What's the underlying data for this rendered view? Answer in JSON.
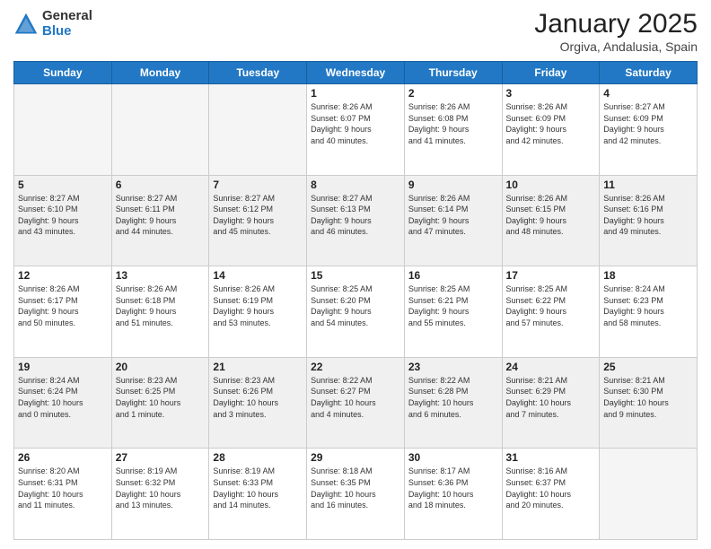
{
  "header": {
    "logo_general": "General",
    "logo_blue": "Blue",
    "title": "January 2025",
    "location": "Orgiva, Andalusia, Spain"
  },
  "days_of_week": [
    "Sunday",
    "Monday",
    "Tuesday",
    "Wednesday",
    "Thursday",
    "Friday",
    "Saturday"
  ],
  "weeks": [
    {
      "stripe": false,
      "days": [
        {
          "num": "",
          "info": ""
        },
        {
          "num": "",
          "info": ""
        },
        {
          "num": "",
          "info": ""
        },
        {
          "num": "1",
          "info": "Sunrise: 8:26 AM\nSunset: 6:07 PM\nDaylight: 9 hours\nand 40 minutes."
        },
        {
          "num": "2",
          "info": "Sunrise: 8:26 AM\nSunset: 6:08 PM\nDaylight: 9 hours\nand 41 minutes."
        },
        {
          "num": "3",
          "info": "Sunrise: 8:26 AM\nSunset: 6:09 PM\nDaylight: 9 hours\nand 42 minutes."
        },
        {
          "num": "4",
          "info": "Sunrise: 8:27 AM\nSunset: 6:09 PM\nDaylight: 9 hours\nand 42 minutes."
        }
      ]
    },
    {
      "stripe": true,
      "days": [
        {
          "num": "5",
          "info": "Sunrise: 8:27 AM\nSunset: 6:10 PM\nDaylight: 9 hours\nand 43 minutes."
        },
        {
          "num": "6",
          "info": "Sunrise: 8:27 AM\nSunset: 6:11 PM\nDaylight: 9 hours\nand 44 minutes."
        },
        {
          "num": "7",
          "info": "Sunrise: 8:27 AM\nSunset: 6:12 PM\nDaylight: 9 hours\nand 45 minutes."
        },
        {
          "num": "8",
          "info": "Sunrise: 8:27 AM\nSunset: 6:13 PM\nDaylight: 9 hours\nand 46 minutes."
        },
        {
          "num": "9",
          "info": "Sunrise: 8:26 AM\nSunset: 6:14 PM\nDaylight: 9 hours\nand 47 minutes."
        },
        {
          "num": "10",
          "info": "Sunrise: 8:26 AM\nSunset: 6:15 PM\nDaylight: 9 hours\nand 48 minutes."
        },
        {
          "num": "11",
          "info": "Sunrise: 8:26 AM\nSunset: 6:16 PM\nDaylight: 9 hours\nand 49 minutes."
        }
      ]
    },
    {
      "stripe": false,
      "days": [
        {
          "num": "12",
          "info": "Sunrise: 8:26 AM\nSunset: 6:17 PM\nDaylight: 9 hours\nand 50 minutes."
        },
        {
          "num": "13",
          "info": "Sunrise: 8:26 AM\nSunset: 6:18 PM\nDaylight: 9 hours\nand 51 minutes."
        },
        {
          "num": "14",
          "info": "Sunrise: 8:26 AM\nSunset: 6:19 PM\nDaylight: 9 hours\nand 53 minutes."
        },
        {
          "num": "15",
          "info": "Sunrise: 8:25 AM\nSunset: 6:20 PM\nDaylight: 9 hours\nand 54 minutes."
        },
        {
          "num": "16",
          "info": "Sunrise: 8:25 AM\nSunset: 6:21 PM\nDaylight: 9 hours\nand 55 minutes."
        },
        {
          "num": "17",
          "info": "Sunrise: 8:25 AM\nSunset: 6:22 PM\nDaylight: 9 hours\nand 57 minutes."
        },
        {
          "num": "18",
          "info": "Sunrise: 8:24 AM\nSunset: 6:23 PM\nDaylight: 9 hours\nand 58 minutes."
        }
      ]
    },
    {
      "stripe": true,
      "days": [
        {
          "num": "19",
          "info": "Sunrise: 8:24 AM\nSunset: 6:24 PM\nDaylight: 10 hours\nand 0 minutes."
        },
        {
          "num": "20",
          "info": "Sunrise: 8:23 AM\nSunset: 6:25 PM\nDaylight: 10 hours\nand 1 minute."
        },
        {
          "num": "21",
          "info": "Sunrise: 8:23 AM\nSunset: 6:26 PM\nDaylight: 10 hours\nand 3 minutes."
        },
        {
          "num": "22",
          "info": "Sunrise: 8:22 AM\nSunset: 6:27 PM\nDaylight: 10 hours\nand 4 minutes."
        },
        {
          "num": "23",
          "info": "Sunrise: 8:22 AM\nSunset: 6:28 PM\nDaylight: 10 hours\nand 6 minutes."
        },
        {
          "num": "24",
          "info": "Sunrise: 8:21 AM\nSunset: 6:29 PM\nDaylight: 10 hours\nand 7 minutes."
        },
        {
          "num": "25",
          "info": "Sunrise: 8:21 AM\nSunset: 6:30 PM\nDaylight: 10 hours\nand 9 minutes."
        }
      ]
    },
    {
      "stripe": false,
      "days": [
        {
          "num": "26",
          "info": "Sunrise: 8:20 AM\nSunset: 6:31 PM\nDaylight: 10 hours\nand 11 minutes."
        },
        {
          "num": "27",
          "info": "Sunrise: 8:19 AM\nSunset: 6:32 PM\nDaylight: 10 hours\nand 13 minutes."
        },
        {
          "num": "28",
          "info": "Sunrise: 8:19 AM\nSunset: 6:33 PM\nDaylight: 10 hours\nand 14 minutes."
        },
        {
          "num": "29",
          "info": "Sunrise: 8:18 AM\nSunset: 6:35 PM\nDaylight: 10 hours\nand 16 minutes."
        },
        {
          "num": "30",
          "info": "Sunrise: 8:17 AM\nSunset: 6:36 PM\nDaylight: 10 hours\nand 18 minutes."
        },
        {
          "num": "31",
          "info": "Sunrise: 8:16 AM\nSunset: 6:37 PM\nDaylight: 10 hours\nand 20 minutes."
        },
        {
          "num": "",
          "info": ""
        }
      ]
    }
  ]
}
